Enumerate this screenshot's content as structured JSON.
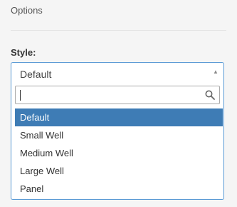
{
  "section": {
    "title": "Options"
  },
  "style_field": {
    "label": "Style:",
    "selected_value": "Default",
    "search_value": "",
    "options": [
      {
        "label": "Default",
        "selected": true
      },
      {
        "label": "Small Well",
        "selected": false
      },
      {
        "label": "Medium Well",
        "selected": false
      },
      {
        "label": "Large Well",
        "selected": false
      },
      {
        "label": "Panel",
        "selected": false
      }
    ]
  },
  "icons": {
    "dropdown_arrow": "triangle-up-icon",
    "search": "search-icon"
  },
  "colors": {
    "accent": "#3e7cb5",
    "focus_border": "#5b9bd5",
    "background": "#f5f5f5"
  }
}
